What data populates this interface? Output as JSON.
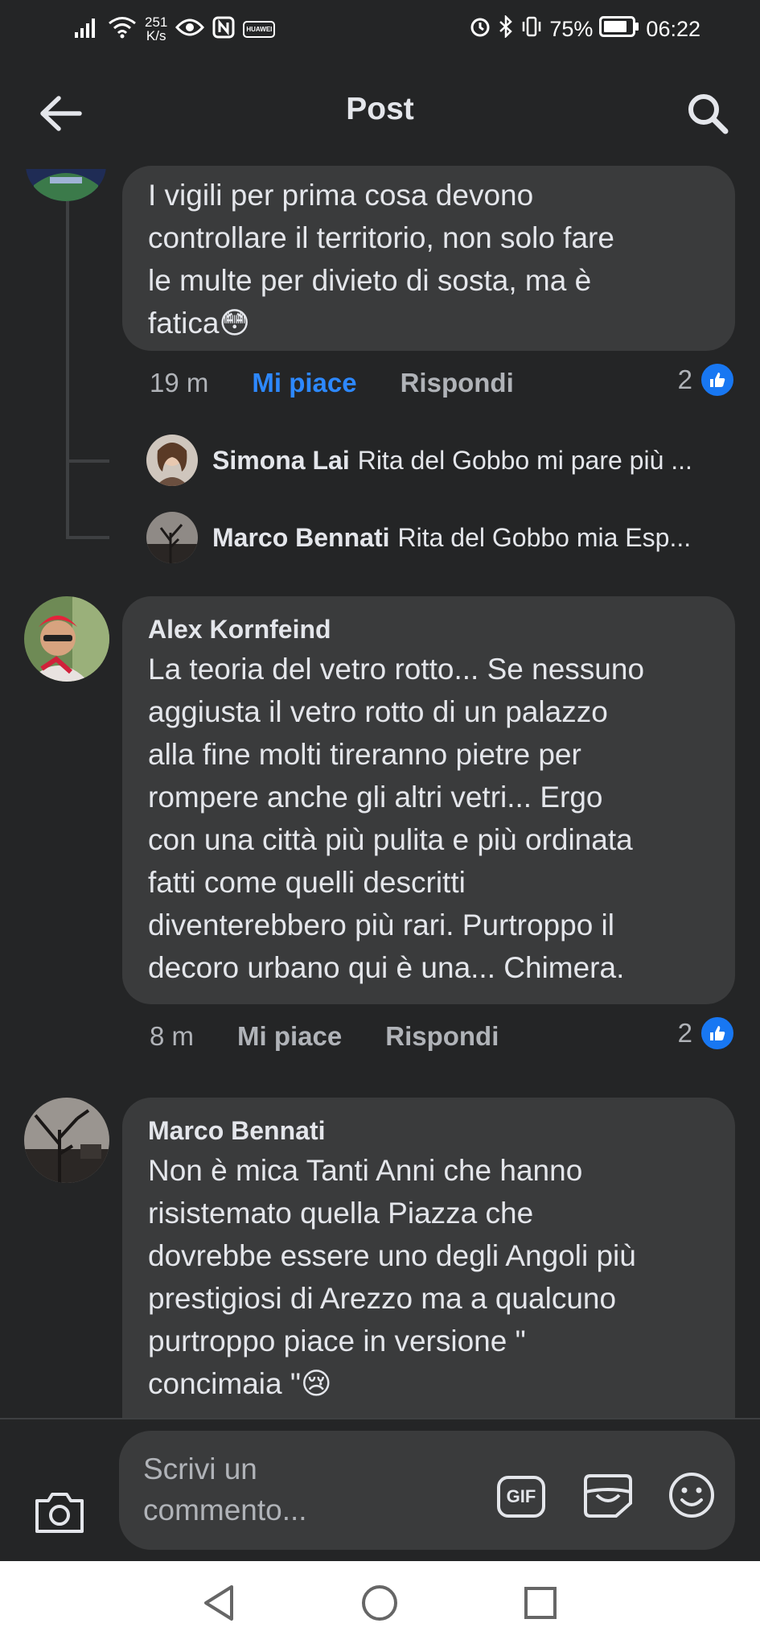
{
  "status_bar": {
    "net_speed": "251",
    "net_speed_unit": "K/s",
    "carrier_chip": "HUAWEI",
    "battery": "75%",
    "time": "06:22",
    "icons": [
      "signal-icon",
      "wifi-icon",
      "eye-icon",
      "nfc-icon",
      "alarm-icon",
      "bluetooth-icon",
      "vibrate-icon",
      "battery-icon"
    ]
  },
  "header": {
    "title": "Post",
    "back_icon": "arrow-left-icon",
    "search_icon": "search-icon"
  },
  "comments": [
    {
      "author": "",
      "text": "I vigili per prima cosa devono\ncontrollare il territorio, non solo fare\nle multe per divieto di sosta, ma è\nfatica😳",
      "time": "19 m",
      "like_label": "Mi piace",
      "like_active": true,
      "reply_label": "Rispondi",
      "likes": "2",
      "replies": [
        {
          "author": "Simona Lai",
          "text": "Rita del Gobbo mi pare più ..."
        },
        {
          "author": "Marco Bennati",
          "text": "Rita del Gobbo mia Esp..."
        }
      ]
    },
    {
      "author": "Alex Kornfeind",
      "text": "La teoria del vetro rotto... Se nessuno\naggiusta il vetro rotto di un palazzo\nalla fine molti tireranno pietre per\nrompere anche gli altri vetri... Ergo\ncon una città più pulita e più ordinata\nfatti come quelli descritti\ndiventerebbero più rari. Purtroppo il\ndecoro urbano qui è una... Chimera.",
      "time": "8 m",
      "like_label": "Mi piace",
      "like_active": false,
      "reply_label": "Rispondi",
      "likes": "2"
    },
    {
      "author": "Marco Bennati",
      "text": "Non è mica Tanti Anni che hanno\nrisistemato quella Piazza che\ndovrebbe essere uno degli Angoli più\nprestigiosi di Arezzo ma a qualcuno\npurtroppo piace in versione \"\nconcimaia \"😢"
    }
  ],
  "composer": {
    "placeholder": "Scrivi un\ncommento...",
    "gif_label": "GIF",
    "icons": [
      "camera-icon",
      "gif-icon",
      "sticker-icon",
      "emoji-icon"
    ]
  },
  "colors": {
    "background": "#242526",
    "bubble": "#3a3b3c",
    "accent": "#1877f2",
    "muted_text": "#b0b3b8"
  },
  "nav_bar": {
    "icons": [
      "nav-back-icon",
      "nav-home-icon",
      "nav-recents-icon"
    ]
  }
}
